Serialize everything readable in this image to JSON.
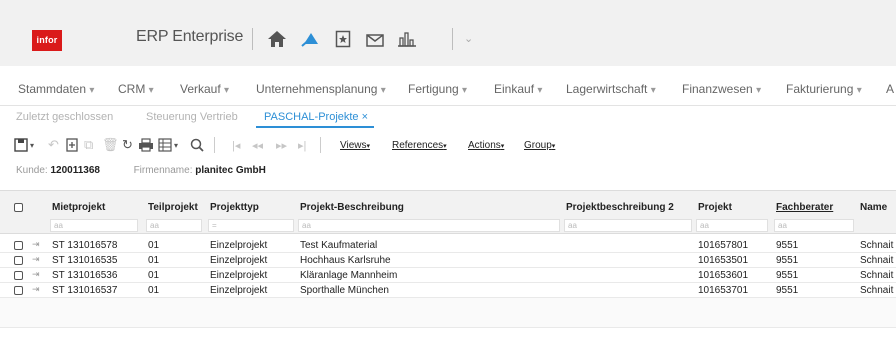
{
  "header": {
    "logo_text": "infor",
    "app_title": "ERP Enterprise",
    "icons": [
      "home-icon",
      "favorites-icon",
      "bookmark-icon",
      "mail-icon",
      "reports-icon"
    ],
    "accent_logo": "#da1a1a",
    "accent_blue": "#2d8fd6"
  },
  "menu": {
    "items": [
      {
        "label": "Stammdaten"
      },
      {
        "label": "CRM"
      },
      {
        "label": "Verkauf"
      },
      {
        "label": "Unternehmensplanung"
      },
      {
        "label": "Fertigung"
      },
      {
        "label": "Einkauf"
      },
      {
        "label": "Lagerwirtschaft"
      },
      {
        "label": "Finanzwesen"
      },
      {
        "label": "Fakturierung"
      },
      {
        "label": "A"
      }
    ]
  },
  "tabs": [
    {
      "label": "Zuletzt geschlossen"
    },
    {
      "label": "Steuerung Vertrieb"
    },
    {
      "label": "PASCHAL-Projekte"
    }
  ],
  "toolbar": {
    "views": "Views",
    "references": "References",
    "actions": "Actions",
    "group": "Group"
  },
  "info": {
    "kunde_label": "Kunde:",
    "kunde_value": "120011368",
    "firma_label": "Firmenname:",
    "firma_value": "planitec GmbH"
  },
  "table": {
    "columns": [
      "Mietprojekt",
      "Teilprojekt",
      "Projekttyp",
      "Projekt-Beschreibung",
      "Projektbeschreibung 2",
      "Projekt",
      "Fachberater",
      "Name"
    ],
    "filter_placeholders": [
      "aa",
      "aa",
      "=",
      "aa",
      "aa",
      "aa",
      "aa"
    ],
    "rows": [
      {
        "mietprojekt": "ST 131016578",
        "teilprojekt": "01",
        "projekttyp": "Einzelprojekt",
        "beschreibung": "Test Kaufmaterial",
        "beschreibung2": "",
        "projekt": "101657801",
        "fachberater": "9551",
        "name": "Schnait"
      },
      {
        "mietprojekt": "ST 131016535",
        "teilprojekt": "01",
        "projekttyp": "Einzelprojekt",
        "beschreibung": "Hochhaus Karlsruhe",
        "beschreibung2": "",
        "projekt": "101653501",
        "fachberater": "9551",
        "name": "Schnait"
      },
      {
        "mietprojekt": "ST 131016536",
        "teilprojekt": "01",
        "projekttyp": "Einzelprojekt",
        "beschreibung": "Kläranlage Mannheim",
        "beschreibung2": "",
        "projekt": "101653601",
        "fachberater": "9551",
        "name": "Schnait"
      },
      {
        "mietprojekt": "ST 131016537",
        "teilprojekt": "01",
        "projekttyp": "Einzelprojekt",
        "beschreibung": "Sporthalle München",
        "beschreibung2": "",
        "projekt": "101653701",
        "fachberater": "9551",
        "name": "Schnait"
      }
    ]
  }
}
